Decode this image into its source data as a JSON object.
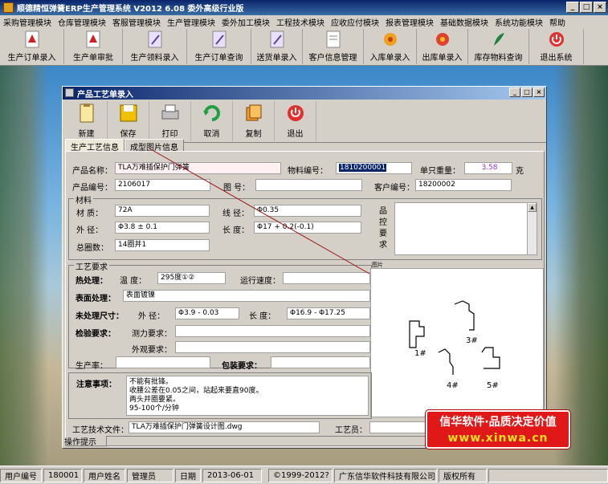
{
  "app": {
    "title": "顺德精恒弹簧ERP生产管理系统  V2012 6.08 委外高级行业版"
  },
  "menu": [
    "采购管理模块",
    "仓库管理模块",
    "客服管理模块",
    "生产管理模块",
    "委外加工模块",
    "工程技术模块",
    "应收应付模块",
    "报表管理模块",
    "基础数据模块",
    "系统功能模块",
    "帮助"
  ],
  "toolbar": [
    "生产订单录入",
    "生产单审批",
    "生产领料录入",
    "生产订单查询",
    "送货单录入",
    "客户信息管理",
    "入库单录入",
    "出库单录入",
    "库存物料查询",
    "退出系统"
  ],
  "child": {
    "title": "产品工艺单录入",
    "buttons": [
      "新建",
      "保存",
      "打印",
      "取消",
      "复制",
      "退出"
    ],
    "tabs": [
      "生产工艺信息",
      "成型图片信息"
    ],
    "product_name_label": "产品名称：",
    "product_name": "TLA万难插保护门弹簧",
    "material_no_label": "物料编号：",
    "material_no": "1810200001",
    "unit_weight_label": "单只重量：",
    "unit_weight": "3.58",
    "unit_weight_unit": "克",
    "product_code_label": "产品编号：",
    "product_code": "2106017",
    "drawing_no_label": "图  号：",
    "drawing_no": "",
    "customer_code_label": "客户编号：",
    "customer_code": "18200002",
    "material_group": "材料",
    "material_label": "材  质：",
    "material": "72A",
    "wire_dia_label": "线  径：",
    "wire_dia": "Φ0.35",
    "outer_dia_label": "外  径：",
    "outer_dia": "Φ3.8 ± 0.1",
    "length_label": "长  度：",
    "length": "Φ17 + 0.2(-0.1)",
    "total_coils_label": "总圈数：",
    "total_coils": "14圈并1",
    "qc_label": "品\n控\n要\n求",
    "process_group": "工艺要求",
    "heat_label": "热处理：",
    "temp_label": "温  度：",
    "temp": "295度①②",
    "speed_label": "运行速度：",
    "speed": "",
    "surface_label": "表面处理：",
    "surface": "表面镀镍",
    "untreated_label": "未处理尺寸：",
    "outer_dia2_label": "外  径：",
    "outer_dia2": "Φ3.9 - 0.03",
    "length2_label": "长  度：",
    "length2": "Φ16.9 - Φ17.25",
    "inspect_label": "检验要求：",
    "force_label": "测力要求：",
    "appearance_label": "外观要求：",
    "yield_label": "生产率：",
    "packing_label": "包装要求：",
    "notes_label": "注意事项：",
    "notes": [
      "不能有批锋。",
      "收腰公差在0.05之间，站起来要直90度。",
      "两头并圈要紧。",
      "95-100个/分钟"
    ],
    "doc_label": "工艺技术文件：",
    "doc": "TLA万难插保护门弹簧设计图.dwg",
    "craftsman_label": "工艺员：",
    "image_label": "图片",
    "shapes": [
      "1#",
      "3#",
      "4#",
      "5#"
    ]
  },
  "hint_label": "操作提示",
  "watermark": {
    "line1": "信华软件·品质决定价值",
    "line2": "www.xinwa.cn"
  },
  "status": {
    "user_no_label": "用户编号",
    "user_no": "180001",
    "user_name_label": "用户姓名",
    "user_name": "管理员",
    "date_label": "日期",
    "date": "2013-06-01",
    "copyright": "©1999-2012?",
    "company": "广东信华软件科技有限公司",
    "rights": "版权所有"
  },
  "colors": {
    "title_blue": "#0a246a",
    "field_selected": "#0a246a",
    "weight_purple": "#9932cc",
    "watermark_red": "#e01818"
  }
}
